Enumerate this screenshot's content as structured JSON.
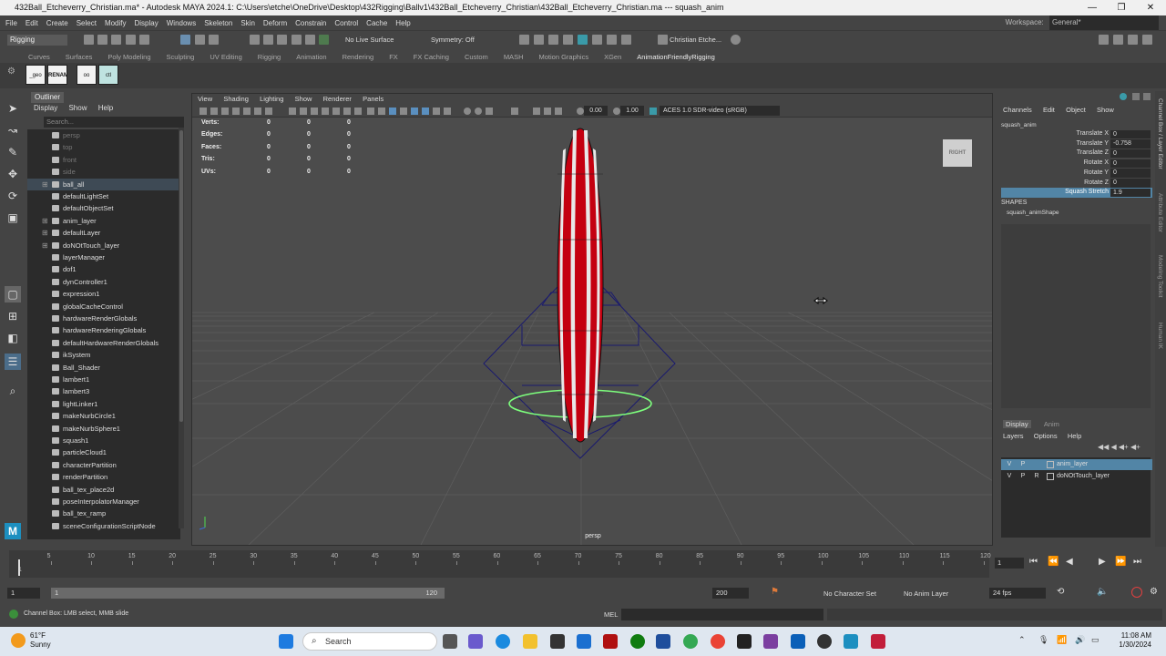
{
  "window": {
    "title": "432Ball_Etcheverry_Christian.ma* - Autodesk MAYA 2024.1: C:\\Users\\etche\\OneDrive\\Desktop\\432Rigging\\Ballv1\\432Ball_Etcheverry_Christian\\432Ball_Etcheverry_Christian.ma   ---   squash_anim",
    "minimize": "—",
    "maximize": "❐",
    "close": "✕"
  },
  "menubar": {
    "items": [
      "File",
      "Edit",
      "Create",
      "Select",
      "Modify",
      "Display",
      "Windows",
      "Skeleton",
      "Skin",
      "Deform",
      "Constrain",
      "Control",
      "Cache",
      "Help"
    ],
    "workspace_label": "Workspace:",
    "workspace_value": "General*"
  },
  "statusline": {
    "menuset": "Rigging",
    "live_surface": "No Live Surface",
    "symmetry": "Symmetry: Off",
    "user": "Christian Etche..."
  },
  "shelf": {
    "tabs": [
      "Curves",
      "Surfaces",
      "Poly Modeling",
      "Sculpting",
      "UV Editing",
      "Rigging",
      "Animation",
      "Rendering",
      "FX",
      "FX Caching",
      "Custom",
      "MASH",
      "Motion Graphics",
      "XGen",
      "AnimationFriendlyRigging"
    ],
    "active_tab": "AnimationFriendlyRigging",
    "icons": [
      "_geo",
      "RENAME",
      "oo",
      "ctl"
    ]
  },
  "outliner": {
    "tab": "Outliner",
    "menu": [
      "Display",
      "Show",
      "Help"
    ],
    "search_placeholder": "Search...",
    "items": [
      {
        "label": "persp",
        "dim": true
      },
      {
        "label": "top",
        "dim": true
      },
      {
        "label": "front",
        "dim": true
      },
      {
        "label": "side",
        "dim": true
      },
      {
        "label": "ball_all",
        "selected": true,
        "expand": true
      },
      {
        "label": "defaultLightSet"
      },
      {
        "label": "defaultObjectSet"
      },
      {
        "label": "anim_layer",
        "expand": true
      },
      {
        "label": "defaultLayer",
        "expand": true
      },
      {
        "label": "doNOtTouch_layer",
        "expand": true
      },
      {
        "label": "layerManager"
      },
      {
        "label": "dof1"
      },
      {
        "label": "dynController1"
      },
      {
        "label": "expression1"
      },
      {
        "label": "globalCacheControl"
      },
      {
        "label": "hardwareRenderGlobals"
      },
      {
        "label": "hardwareRenderingGlobals"
      },
      {
        "label": "defaultHardwareRenderGlobals"
      },
      {
        "label": "ikSystem"
      },
      {
        "label": "Ball_Shader"
      },
      {
        "label": "lambert1"
      },
      {
        "label": "lambert3"
      },
      {
        "label": "lightLinker1"
      },
      {
        "label": "makeNurbCircle1"
      },
      {
        "label": "makeNurbSphere1"
      },
      {
        "label": "squash1"
      },
      {
        "label": "particleCloud1"
      },
      {
        "label": "characterPartition"
      },
      {
        "label": "renderPartition"
      },
      {
        "label": "ball_tex_place2d"
      },
      {
        "label": "poseInterpolatorManager"
      },
      {
        "label": "ball_tex_ramp"
      },
      {
        "label": "sceneConfigurationScriptNode"
      }
    ]
  },
  "viewport": {
    "menu": [
      "View",
      "Shading",
      "Lighting",
      "Show",
      "Renderer",
      "Panels"
    ],
    "exposure": "0.00",
    "gamma": "1.00",
    "color_space": "ACES 1.0 SDR-video (sRGB)",
    "hud": [
      {
        "label": "Verts:",
        "a": "0",
        "b": "0",
        "c": "0"
      },
      {
        "label": "Edges:",
        "a": "0",
        "b": "0",
        "c": "0"
      },
      {
        "label": "Faces:",
        "a": "0",
        "b": "0",
        "c": "0"
      },
      {
        "label": "Tris:",
        "a": "0",
        "b": "0",
        "c": "0"
      },
      {
        "label": "UVs:",
        "a": "0",
        "b": "0",
        "c": "0"
      }
    ],
    "camera_label": "persp",
    "viewcube_label": "RIGHT",
    "ball_colors": {
      "red": "#c40010",
      "white": "#e8e8e8",
      "ctrl_green": "#7dff7d",
      "ctrl_blue": "#1a1a6e"
    }
  },
  "channelbox": {
    "menu": [
      "Channels",
      "Edit",
      "Object",
      "Show"
    ],
    "object": "squash_anim",
    "channels": [
      {
        "name": "Translate X",
        "value": "0"
      },
      {
        "name": "Translate Y",
        "value": "-0.758"
      },
      {
        "name": "Translate Z",
        "value": "0"
      },
      {
        "name": "Rotate X",
        "value": "0"
      },
      {
        "name": "Rotate Y",
        "value": "0"
      },
      {
        "name": "Rotate Z",
        "value": "0"
      },
      {
        "name": "Squash Stretch",
        "value": "1.9",
        "highlight": true
      }
    ],
    "shapes_header": "SHAPES",
    "shape": "squash_animShape"
  },
  "right_strip": [
    "Channel Box / Layer Editor",
    "Attribute Editor",
    "Modeling Toolkit",
    "Human IK"
  ],
  "layers": {
    "tabs": [
      "Display",
      "Anim"
    ],
    "menu": [
      "Layers",
      "Options",
      "Help"
    ],
    "rows": [
      {
        "v": "V",
        "p": "P",
        "r": "",
        "name": "anim_layer",
        "selected": true
      },
      {
        "v": "V",
        "p": "P",
        "r": "R",
        "name": "doNOtTouch_layer"
      }
    ]
  },
  "timeslider": {
    "ticks": [
      "1",
      "5",
      "10",
      "15",
      "20",
      "25",
      "30",
      "35",
      "40",
      "45",
      "50",
      "55",
      "60",
      "65",
      "70",
      "75",
      "80",
      "85",
      "90",
      "95",
      "100",
      "105",
      "110",
      "115",
      "120"
    ],
    "current_frame": "1",
    "playback": [
      "⏮",
      "⏪",
      "◀",
      "▶",
      "⏩",
      "⏭"
    ]
  },
  "range": {
    "start": "1",
    "range_start": "1",
    "range_end": "120",
    "end": "200",
    "character_set": "No Character Set",
    "anim_layer": "No Anim Layer",
    "fps": "24 fps"
  },
  "cmdline": {
    "help": "Channel Box: LMB select, MMB slide",
    "mel": "MEL"
  },
  "taskbar": {
    "temp": "61°F",
    "weather": "Sunny",
    "search": "Search",
    "time": "11:08 AM",
    "date": "1/30/2024"
  }
}
